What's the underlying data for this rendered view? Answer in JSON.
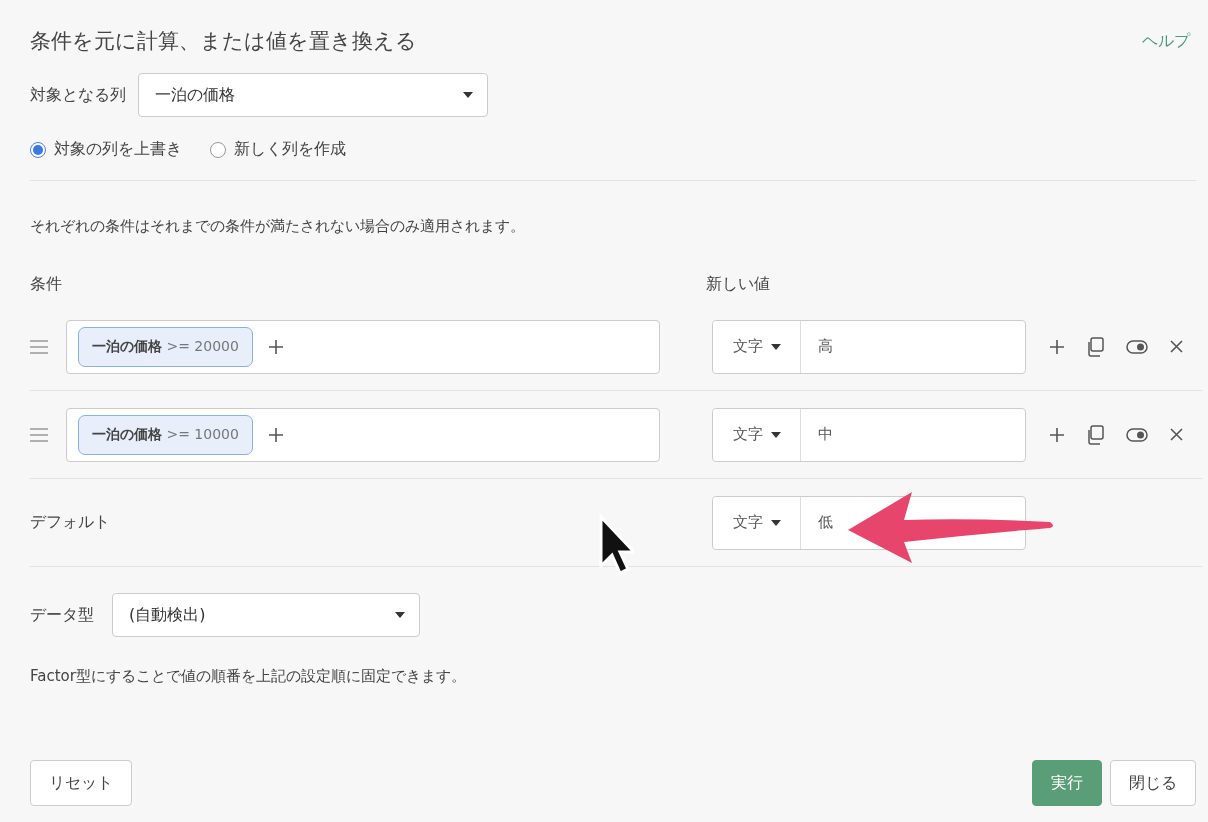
{
  "title": "条件を元に計算、または値を置き換える",
  "help_link": "ヘルプ",
  "target_column": {
    "label": "対象となる列",
    "value": "一泊の価格"
  },
  "output_mode": [
    {
      "label": "対象の列を上書き",
      "selected": true
    },
    {
      "label": "新しく列を作成",
      "selected": false
    }
  ],
  "note": "それぞれの条件はそれまでの条件が満たされない場合のみ適用されます。",
  "condition_header": "条件",
  "new_value_header": "新しい値",
  "rules": [
    {
      "condition": "**一泊の価格** >= 20000",
      "type": "文字",
      "value": "高"
    },
    {
      "condition": "**一泊の価格** >= 10000",
      "type": "文字",
      "value": "中"
    }
  ],
  "default": {
    "label": "デフォルト",
    "type": "文字",
    "value": "低"
  },
  "data_type": {
    "label": "データ型",
    "value": "(自動検出)"
  },
  "factor_note": "Factor型にすることで値の順番を上記の設定順に固定できます。",
  "buttons": {
    "reset": "リセット",
    "run": "実行",
    "close": "閉じる"
  }
}
